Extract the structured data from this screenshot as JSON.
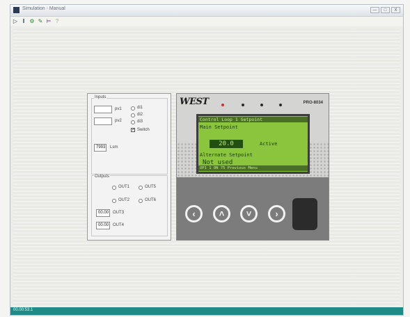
{
  "window": {
    "title": "Simulation - Manual",
    "btn_min": "—",
    "btn_max": "□",
    "btn_close": "X"
  },
  "toolbar": {
    "icons": [
      "run-icon",
      "pause-icon",
      "settings-icon",
      "chart-icon",
      "scale-icon",
      "help-icon"
    ]
  },
  "inputs": {
    "group_label": "Inputs",
    "pv1_value": "",
    "pv1_label": "pv1",
    "pv2_value": "",
    "pv2_label": "pv2",
    "radio_1": "di1",
    "radio_2": "di2",
    "radio_3": "di3",
    "switch_label": "Switch",
    "switch_checked": true,
    "lsm_value": "7993",
    "lsm_label": "Lsm"
  },
  "outputs": {
    "group_label": "Outputs",
    "out1": "OUT1",
    "out5": "OUT5",
    "out2": "OUT2",
    "out6": "OUT6",
    "out3_value": "00.00",
    "out3_label": "OUT3",
    "out4_value": "00.00",
    "out4_label": "OUT4"
  },
  "device": {
    "brand": "WEST",
    "model": "PRO-8034",
    "lcd_line1": "Control Loop 1 Setpoint",
    "lcd_line2": "Main Setpoint",
    "lcd_value": "20.0",
    "lcd_status": "Active",
    "lcd_line4": "Alternate Setpoint",
    "lcd_line5": "Not used",
    "lcd_footer": "OP1 1 ON 75 Previous Menu"
  },
  "status": {
    "text": "00.00:53.1"
  }
}
